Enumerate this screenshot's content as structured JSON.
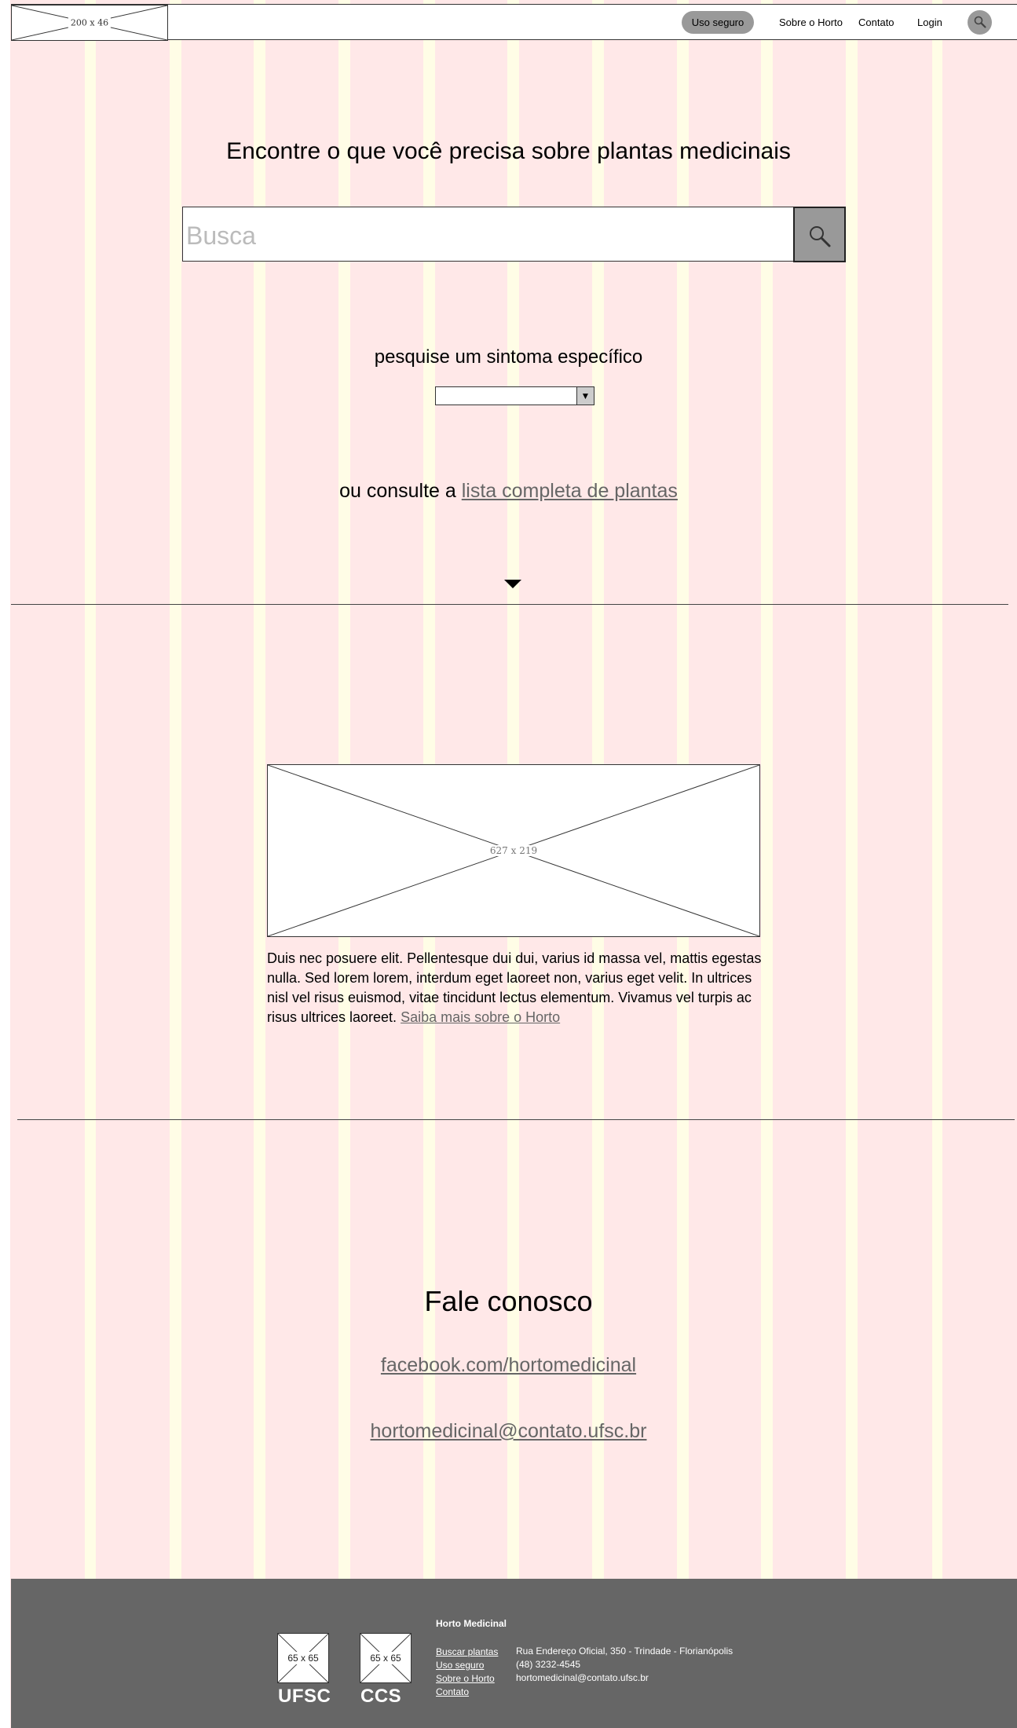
{
  "header": {
    "logo_placeholder": "200 x 46",
    "nav": {
      "safe_use": "Uso seguro",
      "about": "Sobre o Horto",
      "contact": "Contato",
      "login": "Login"
    },
    "search_icon": "search-icon"
  },
  "hero": {
    "title": "Encontre o que você precisa sobre plantas medicinais",
    "search_placeholder": "Busca",
    "search_button_icon": "search-icon",
    "symptom_title": "pesquise um sintoma específico",
    "symptom_select_value": "",
    "consult_prefix": "ou consulte a ",
    "consult_link": "lista completa de plantas",
    "scroll_icon": "caret-down-icon"
  },
  "about": {
    "image_placeholder": "627 x 219",
    "text": "Duis nec posuere elit. Pellentesque dui dui, varius id massa vel, mattis egestas nulla. Sed lorem lorem, interdum eget laoreet non, varius eget velit. In ultrices nisl vel risus euismod, vitae tincidunt lectus elementum. Vivamus vel turpis ac risus ultrices laoreet. ",
    "link": "Saiba mais sobre o Horto"
  },
  "contact": {
    "title": "Fale conosco",
    "facebook": "facebook.com/hortomedicinal",
    "email": "hortomedicinal@contato.ufsc.br"
  },
  "footer": {
    "logos": [
      {
        "placeholder": "65 x 65",
        "name": "UFSC"
      },
      {
        "placeholder": "65 x 65",
        "name": "CCS"
      }
    ],
    "heading": "Horto Medicinal",
    "links": [
      "Buscar plantas",
      "Uso seguro ",
      "Sobre o Horto",
      "Contato"
    ],
    "address": "Rua Endereço Oficial, 350 - Trindade - Florianópolis",
    "phone": "(48) 3232-4545",
    "email": "hortomedicinal@contato.ufsc.br"
  },
  "colors": {
    "column": "#ffe8e8",
    "gutter": "#fffde6",
    "button_gray": "#999999",
    "footer_bg": "#666666",
    "link_gray": "#666666"
  }
}
